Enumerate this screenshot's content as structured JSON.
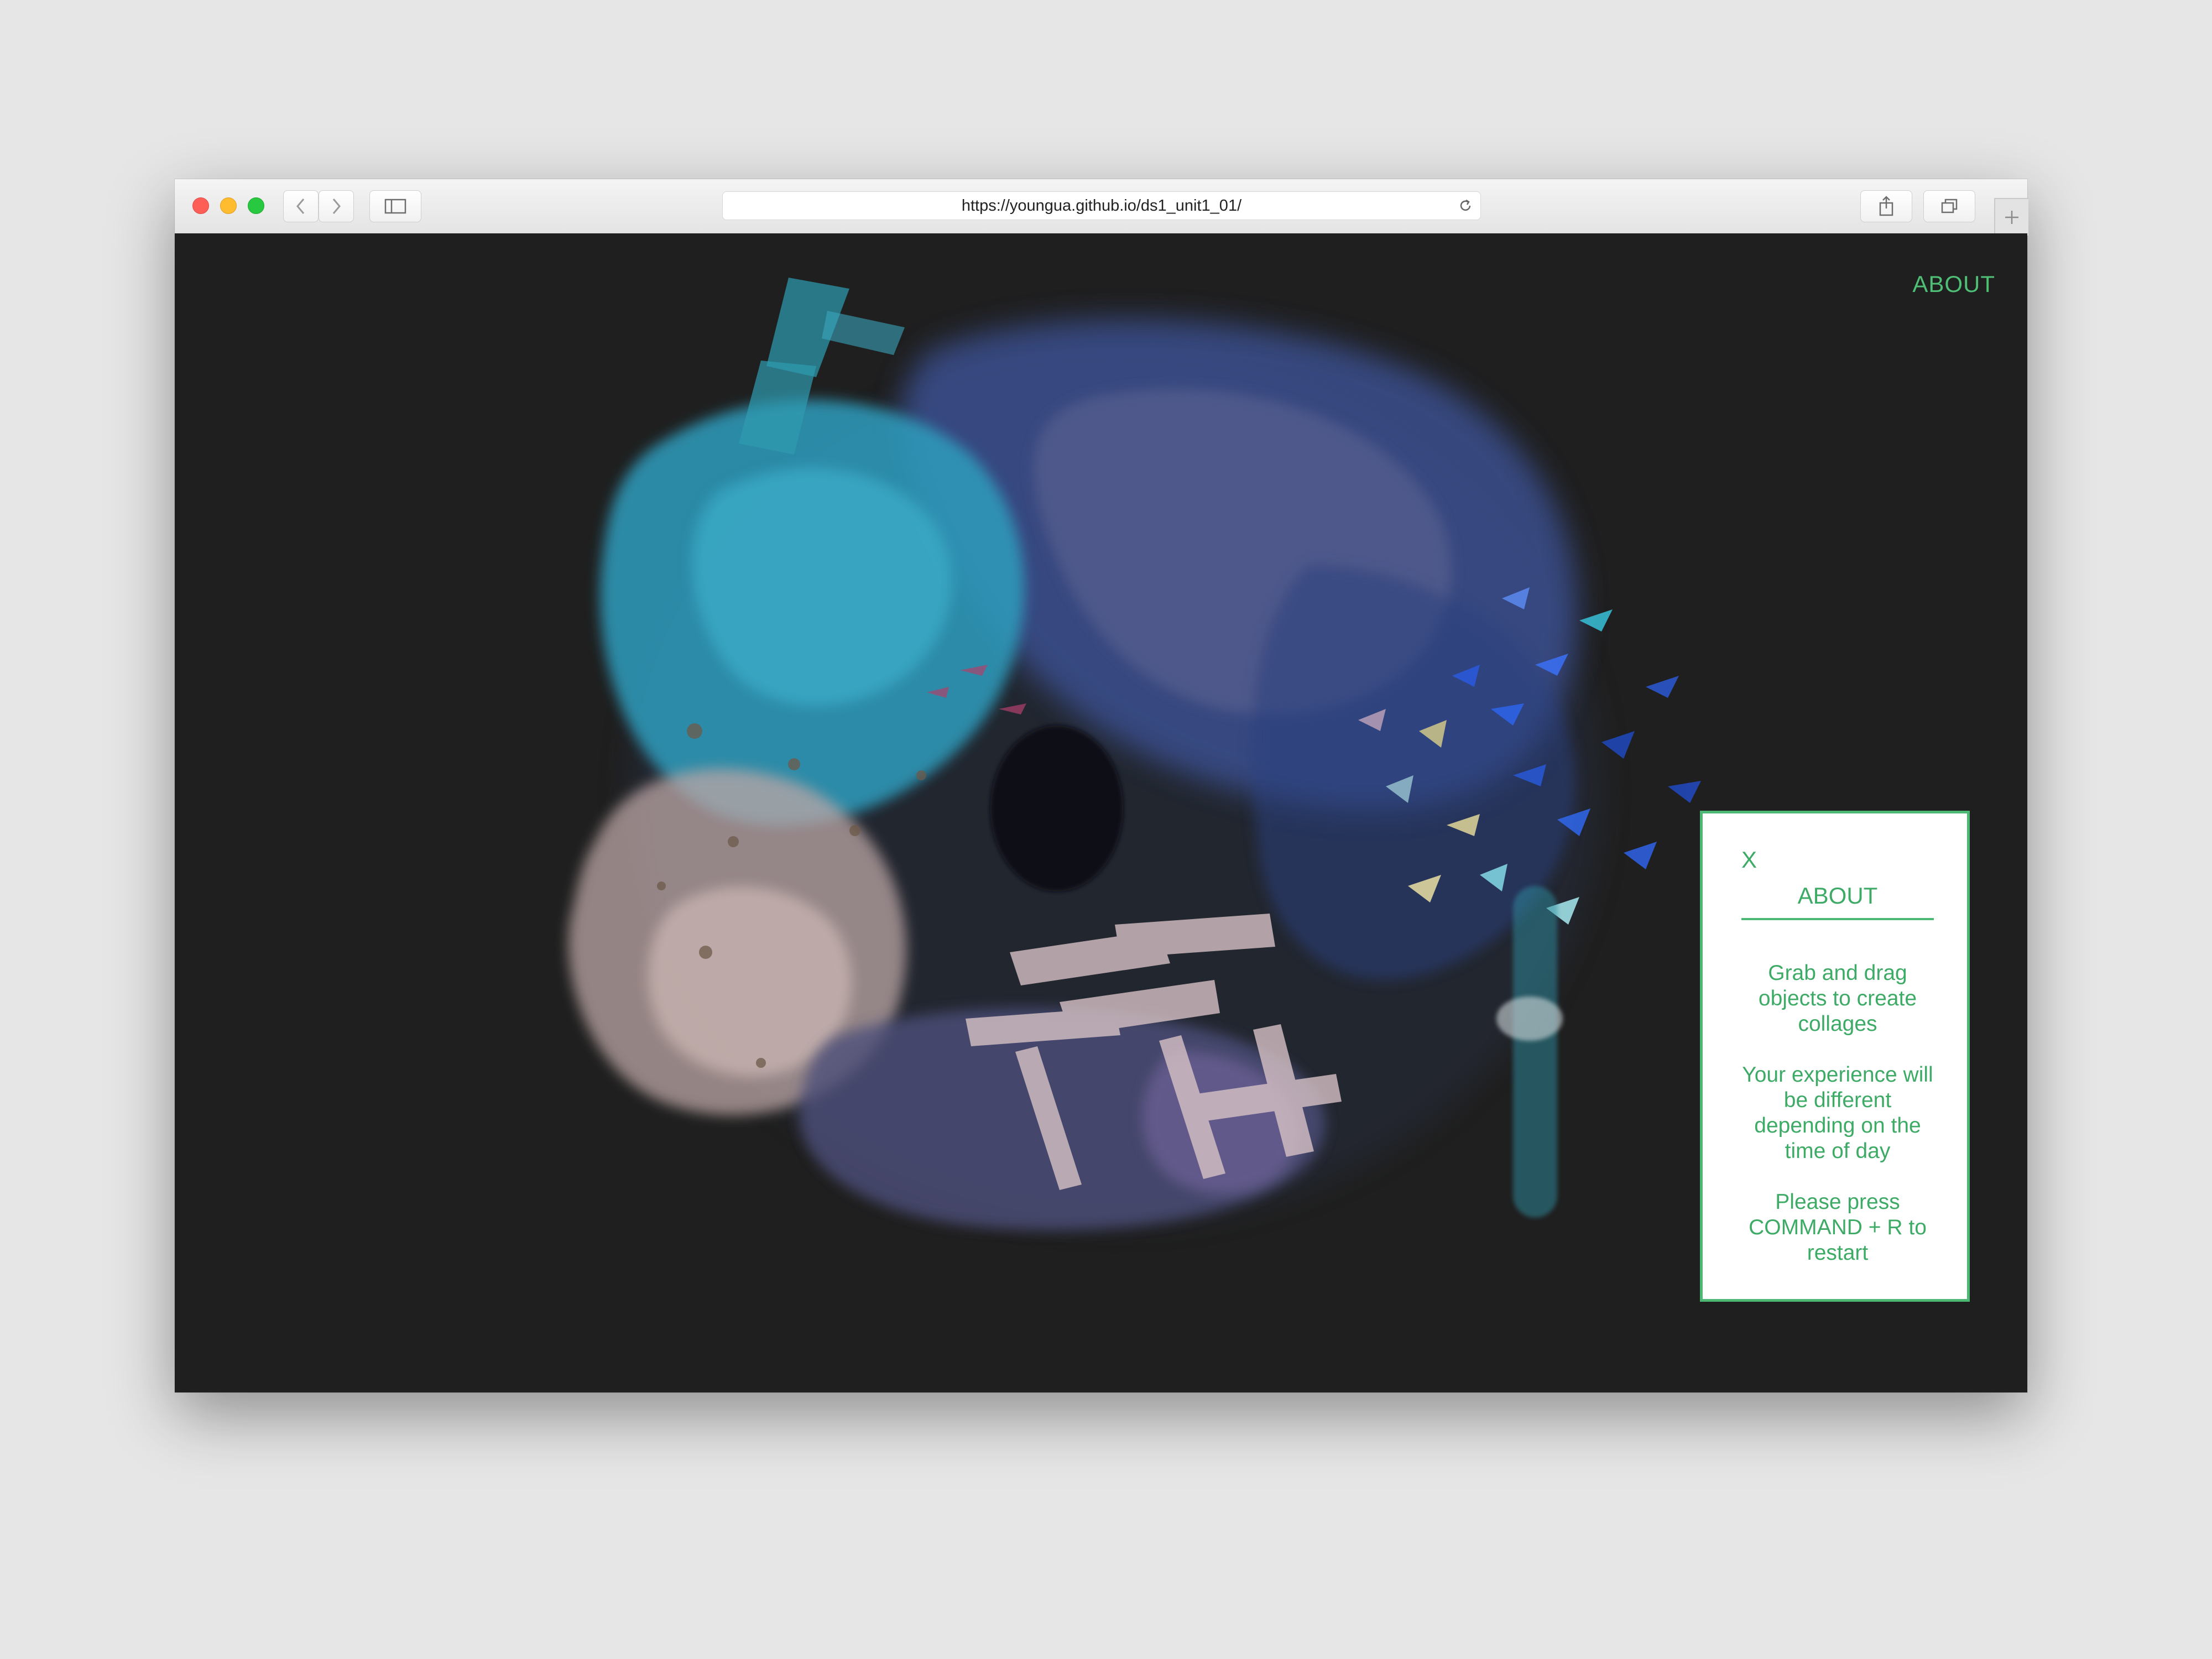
{
  "browser": {
    "url": "https://youngua.github.io/ds1_unit1_01/",
    "nav_back_icon": "chevron-left-icon",
    "nav_forward_icon": "chevron-right-icon",
    "sidebar_icon": "sidebar-icon",
    "share_icon": "share-icon",
    "tabs_icon": "tabs-overview-icon",
    "reload_icon": "reload-icon",
    "new_tab_icon": "plus-icon"
  },
  "page": {
    "about_link": "ABOUT"
  },
  "about_panel": {
    "close_label": "X",
    "title": "ABOUT",
    "paragraphs": [
      "Grab and drag objects to create collages",
      "Your experience will be different depending on the time of day",
      "Please press COMMAND + R to restart"
    ]
  },
  "colors": {
    "accent": "#4cb873",
    "page_background": "#1f1f1f",
    "desktop": "#e6e6e6"
  }
}
